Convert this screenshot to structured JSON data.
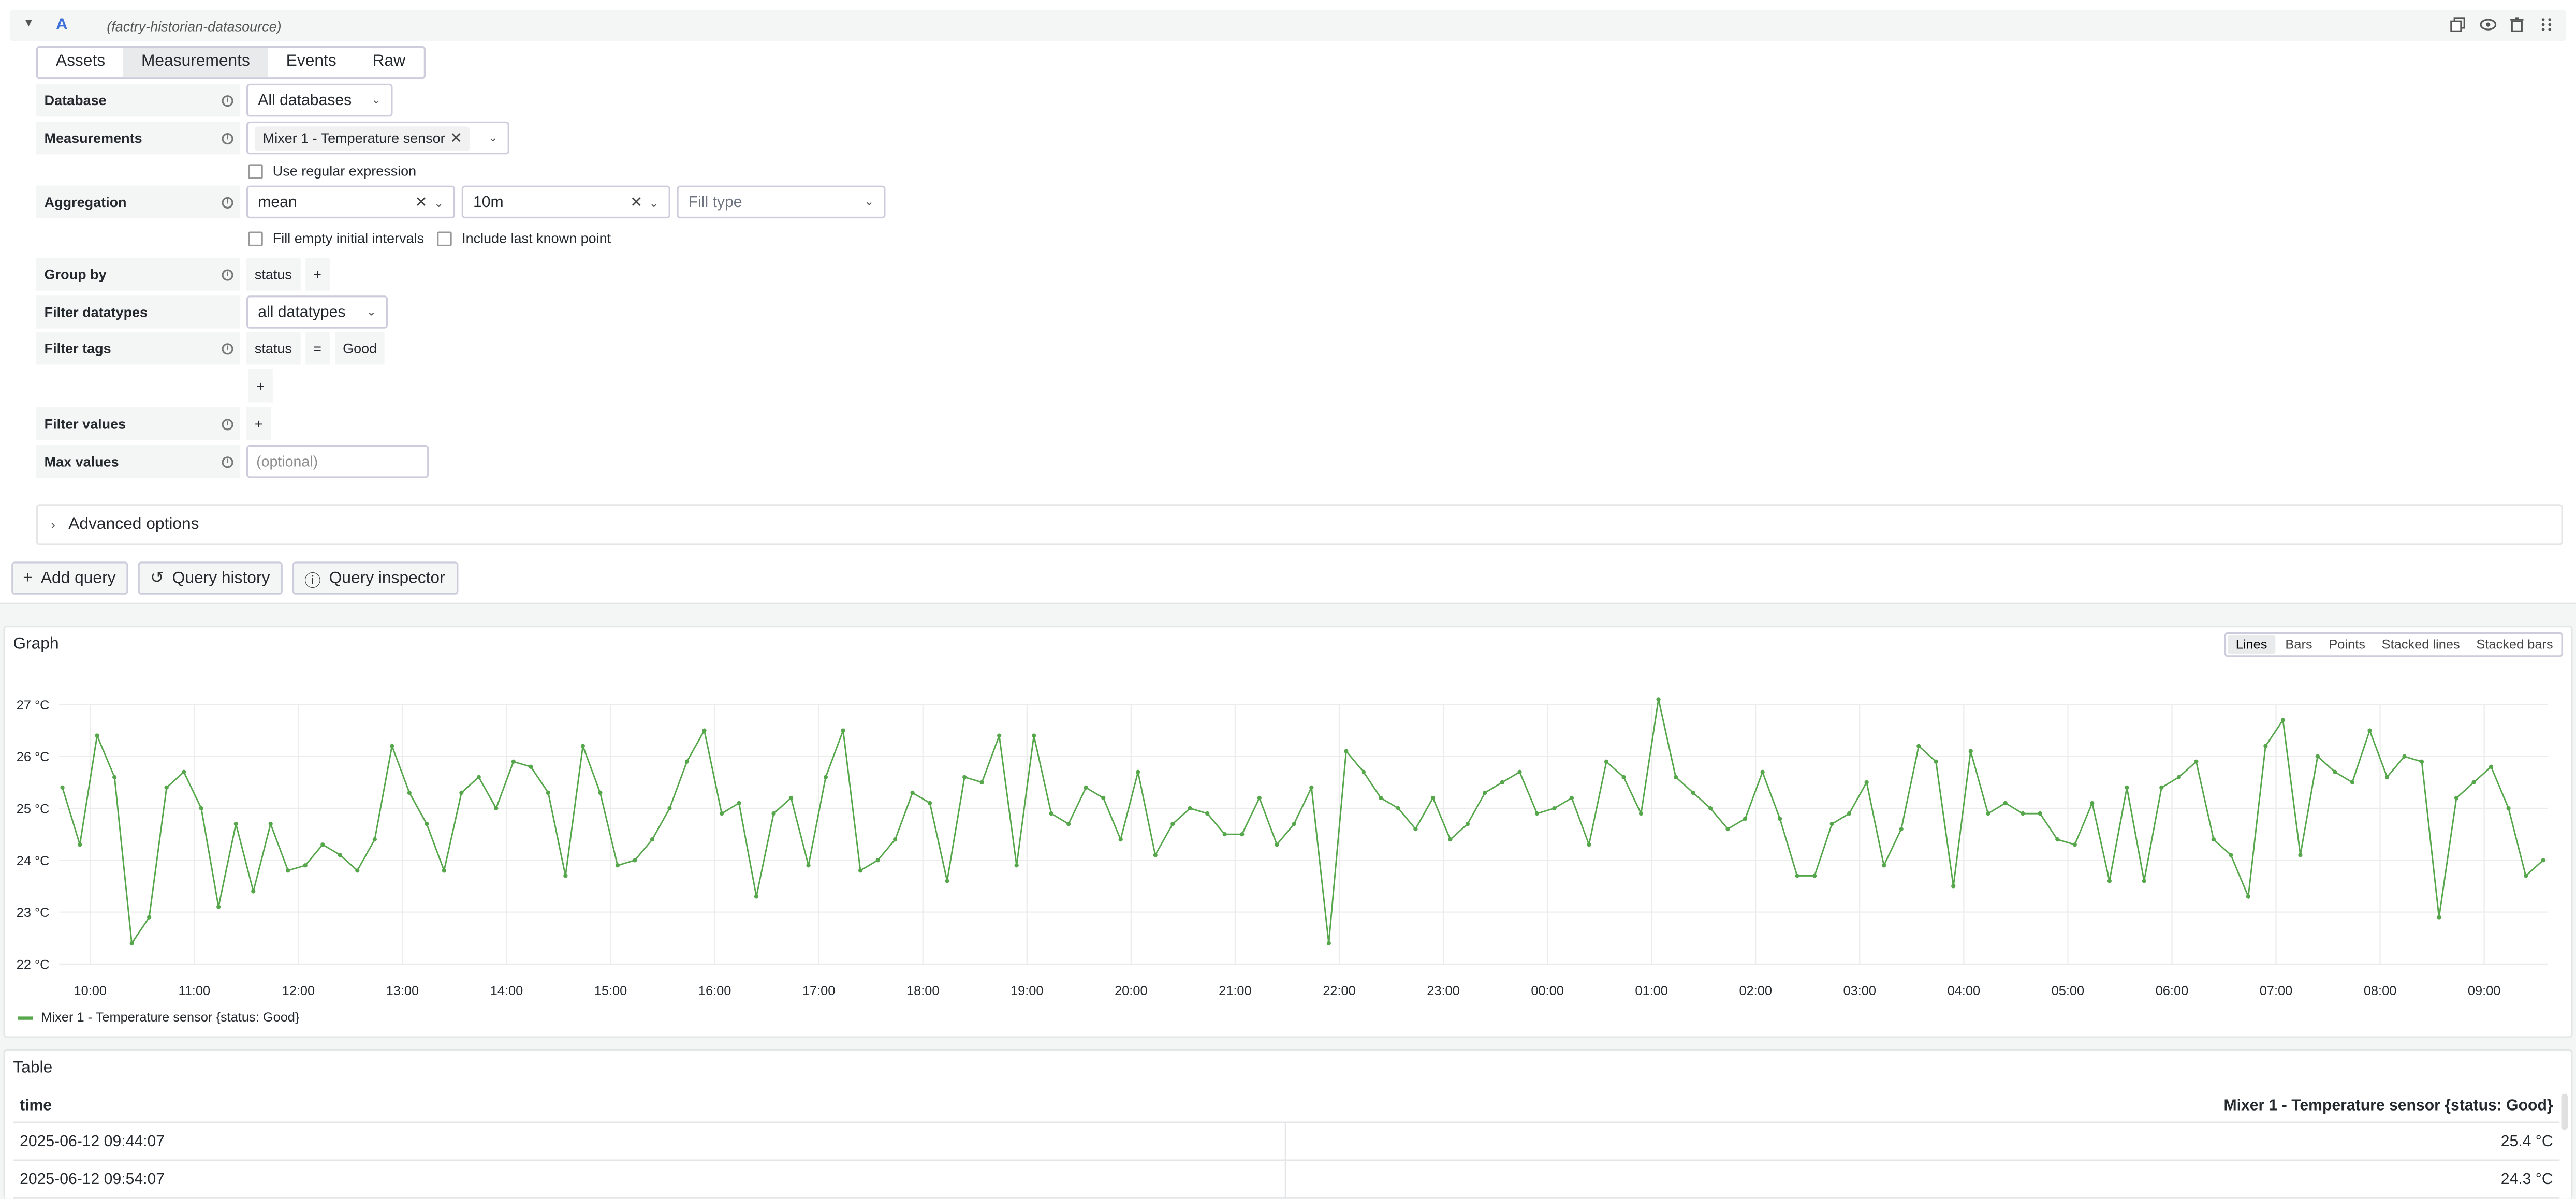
{
  "query": {
    "ref_id": "A",
    "datasource": "(factry-historian-datasource)",
    "tabs": [
      "Assets",
      "Measurements",
      "Events",
      "Raw"
    ],
    "active_tab": "Measurements",
    "database": {
      "label": "Database",
      "value": "All databases"
    },
    "measurements": {
      "label": "Measurements",
      "chip": "Mixer 1 - Temperature sensor"
    },
    "use_regex": "Use regular expression",
    "aggregation": {
      "label": "Aggregation",
      "function": "mean",
      "interval": "10m",
      "fill_placeholder": "Fill type"
    },
    "fill_empty": "Fill empty initial intervals",
    "include_last": "Include last known point",
    "group_by": {
      "label": "Group by",
      "chip": "status",
      "add": "+"
    },
    "filter_datatypes": {
      "label": "Filter datatypes",
      "value": "all datatypes"
    },
    "filter_tags": {
      "label": "Filter tags",
      "key": "status",
      "op": "=",
      "value": "Good",
      "add": "+"
    },
    "filter_values": {
      "label": "Filter values",
      "add": "+"
    },
    "max_values": {
      "label": "Max values",
      "placeholder": "(optional)"
    },
    "advanced": "Advanced options",
    "buttons": {
      "add_query": "Add query",
      "history": "Query history",
      "inspector": "Query inspector"
    }
  },
  "graph": {
    "title": "Graph",
    "modes": [
      "Lines",
      "Bars",
      "Points",
      "Stacked lines",
      "Stacked bars"
    ],
    "active_mode": "Lines",
    "legend": "Mixer 1 - Temperature sensor {status: Good}",
    "colors": {
      "series": "#56a64b",
      "grid": "#ececec"
    }
  },
  "chart_data": {
    "type": "line",
    "title": "",
    "xlabel": "",
    "ylabel": "",
    "ylim": [
      22,
      27
    ],
    "y_tick_labels": [
      "27 °C",
      "26 °C",
      "25 °C",
      "24 °C",
      "23 °C",
      "22 °C"
    ],
    "x_tick_labels": [
      "10:00",
      "11:00",
      "12:00",
      "13:00",
      "14:00",
      "15:00",
      "16:00",
      "17:00",
      "18:00",
      "19:00",
      "20:00",
      "21:00",
      "22:00",
      "23:00",
      "00:00",
      "01:00",
      "02:00",
      "03:00",
      "04:00",
      "05:00",
      "06:00",
      "07:00",
      "08:00",
      "09:00"
    ],
    "x_start": "2025-06-12 09:44:07",
    "interval": "10m",
    "series": [
      {
        "name": "Mixer 1 - Temperature sensor {status: Good}",
        "values": [
          25.4,
          24.3,
          26.4,
          25.6,
          22.4,
          22.9,
          25.4,
          25.7,
          25.0,
          23.1,
          24.7,
          23.4,
          24.7,
          23.8,
          23.9,
          24.3,
          24.1,
          23.8,
          24.4,
          26.2,
          25.3,
          24.7,
          23.8,
          25.3,
          25.6,
          25.0,
          25.9,
          25.8,
          25.3,
          23.7,
          26.2,
          25.3,
          23.9,
          24.0,
          24.4,
          25.0,
          25.9,
          26.5,
          24.9,
          25.1,
          23.3,
          24.9,
          25.2,
          23.9,
          25.6,
          26.5,
          23.8,
          24.0,
          24.4,
          25.3,
          25.1,
          23.6,
          25.6,
          25.5,
          26.4,
          23.9,
          26.4,
          24.9,
          24.7,
          25.4,
          25.2,
          24.4,
          25.7,
          24.1,
          24.7,
          25.0,
          24.9,
          24.5,
          24.5,
          25.2,
          24.3,
          24.7,
          25.4,
          22.4,
          26.1,
          25.7,
          25.2,
          25.0,
          24.6,
          25.2,
          24.4,
          24.7,
          25.3,
          25.5,
          25.7,
          24.9,
          25.0,
          25.2,
          24.3,
          25.9,
          25.6,
          24.9,
          27.1,
          25.6,
          25.3,
          25.0,
          24.6,
          24.8,
          25.7,
          24.8,
          23.7,
          23.7,
          24.7,
          24.9,
          25.5,
          23.9,
          24.6,
          26.2,
          25.9,
          23.5,
          26.1,
          24.9,
          25.1,
          24.9,
          24.9,
          24.4,
          24.3,
          25.1,
          23.6,
          25.4,
          23.6,
          25.4,
          25.6,
          25.9,
          24.4,
          24.1,
          23.3,
          26.2,
          26.7,
          24.1,
          26.0,
          25.7,
          25.5,
          26.5,
          25.6,
          26.0,
          25.9,
          22.9,
          25.2,
          25.5,
          25.8,
          25.0,
          23.7,
          24.0
        ]
      }
    ]
  },
  "table": {
    "title": "Table",
    "columns": [
      "time",
      "Mixer 1 - Temperature sensor {status: Good}"
    ],
    "rows": [
      [
        "2025-06-12 09:44:07",
        "25.4 °C"
      ],
      [
        "2025-06-12 09:54:07",
        "24.3 °C"
      ]
    ]
  }
}
